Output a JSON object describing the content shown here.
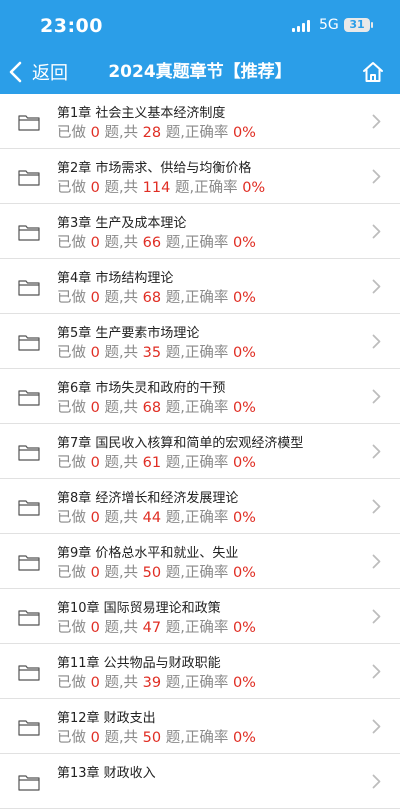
{
  "status_bar": {
    "time": "23:00",
    "network": "5G",
    "battery": "31"
  },
  "nav": {
    "back_label": "返回",
    "title": "2024真题章节【推荐】"
  },
  "colors": {
    "header_bg": "#2b9ee8",
    "accent_red": "#e02e24",
    "muted_text": "#8a8a8a"
  },
  "labels": {
    "done_prefix": "已做",
    "unit": "题,共",
    "unit_end": "题,正确率"
  },
  "chapters": [
    {
      "title": "第1章 社会主义基本经济制度",
      "done": "0",
      "total": "28",
      "rate": "0%"
    },
    {
      "title": "第2章 市场需求、供给与均衡价格",
      "done": "0",
      "total": "114",
      "rate": "0%"
    },
    {
      "title": "第3章 生产及成本理论",
      "done": "0",
      "total": "66",
      "rate": "0%"
    },
    {
      "title": "第4章 市场结构理论",
      "done": "0",
      "total": "68",
      "rate": "0%"
    },
    {
      "title": "第5章 生产要素市场理论",
      "done": "0",
      "total": "35",
      "rate": "0%"
    },
    {
      "title": "第6章 市场失灵和政府的干预",
      "done": "0",
      "total": "68",
      "rate": "0%"
    },
    {
      "title": "第7章 国民收入核算和简单的宏观经济模型",
      "done": "0",
      "total": "61",
      "rate": "0%"
    },
    {
      "title": "第8章 经济增长和经济发展理论",
      "done": "0",
      "total": "44",
      "rate": "0%"
    },
    {
      "title": "第9章 价格总水平和就业、失业",
      "done": "0",
      "total": "50",
      "rate": "0%"
    },
    {
      "title": "第10章 国际贸易理论和政策",
      "done": "0",
      "total": "47",
      "rate": "0%"
    },
    {
      "title": "第11章 公共物品与财政职能",
      "done": "0",
      "total": "39",
      "rate": "0%"
    },
    {
      "title": "第12章 财政支出",
      "done": "0",
      "total": "50",
      "rate": "0%"
    },
    {
      "title": "第13章 财政收入",
      "done": "",
      "total": "",
      "rate": ""
    }
  ]
}
